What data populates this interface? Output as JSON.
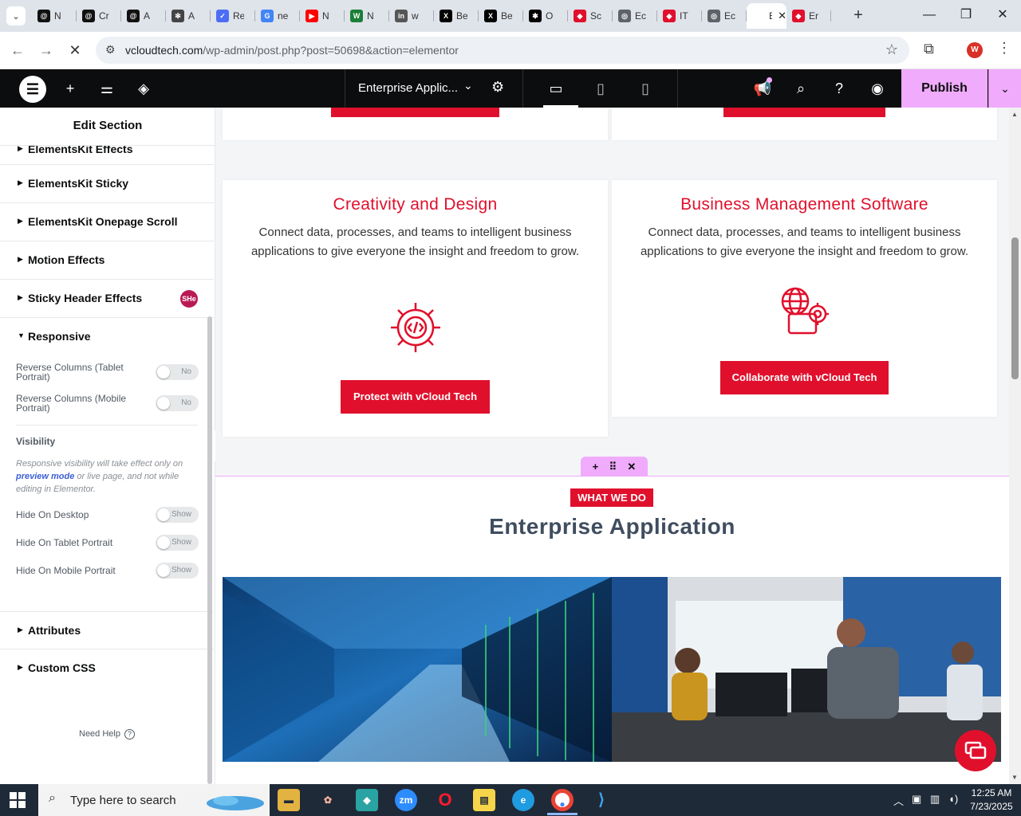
{
  "browser": {
    "tabs": [
      {
        "title": "N",
        "icon": "threads-icon",
        "color": "#111111",
        "glyph": "@"
      },
      {
        "title": "Cr",
        "icon": "threads-icon",
        "color": "#111111",
        "glyph": "@"
      },
      {
        "title": "A",
        "icon": "threads-icon",
        "color": "#111111",
        "glyph": "@"
      },
      {
        "title": "A",
        "icon": "openai-icon",
        "color": "#444444",
        "glyph": "✻"
      },
      {
        "title": "Re",
        "icon": "check-icon",
        "color": "#4c6ef5",
        "glyph": "✓"
      },
      {
        "title": "ne",
        "icon": "google-icon",
        "color": "#4285f4",
        "glyph": "G"
      },
      {
        "title": "N",
        "icon": "youtube-icon",
        "color": "#ff0000",
        "glyph": "▶"
      },
      {
        "title": "N",
        "icon": "w-icon",
        "color": "#1a7f37",
        "glyph": "W"
      },
      {
        "title": "w",
        "icon": "linkedin-icon",
        "color": "#555555",
        "glyph": "in"
      },
      {
        "title": "Be",
        "icon": "x-icon",
        "color": "#000000",
        "glyph": "X"
      },
      {
        "title": "Be",
        "icon": "x-icon",
        "color": "#000000",
        "glyph": "X"
      },
      {
        "title": "O",
        "icon": "asterisk-icon",
        "color": "#000000",
        "glyph": "✱"
      },
      {
        "title": "Sc",
        "icon": "diamond-icon",
        "color": "#e0102c",
        "glyph": "◆"
      },
      {
        "title": "Ec",
        "icon": "globe-icon",
        "color": "#5f6368",
        "glyph": "◎"
      },
      {
        "title": "IT",
        "icon": "diamond-icon",
        "color": "#e0102c",
        "glyph": "◆"
      },
      {
        "title": "Ec",
        "icon": "globe-icon",
        "color": "#5f6368",
        "glyph": "◎"
      },
      {
        "title": "Ec",
        "icon": "elementor-icon",
        "color": "#ffffff",
        "glyph": ""
      },
      {
        "title": "Er",
        "icon": "diamond-icon",
        "color": "#e0102c",
        "glyph": "◆"
      }
    ],
    "url_host": "vcloudtech.com",
    "url_path": "/wp-admin/post.php?post=50698&action=elementor",
    "profile_initial": "W"
  },
  "editor": {
    "document_title": "Enterprise Applic...",
    "publish_label": "Publish",
    "panel_title": "Edit Section",
    "accordions": {
      "elementskit_effects": "ElementsKit Effects",
      "elementskit_sticky": "ElementsKit Sticky",
      "elementskit_onepage": "ElementsKit Onepage Scroll",
      "motion_effects": "Motion Effects",
      "sticky_header": "Sticky Header Effects",
      "sticky_header_badge": "SHe",
      "responsive": "Responsive",
      "attributes": "Attributes",
      "custom_css": "Custom CSS"
    },
    "responsive": {
      "reverse_tablet_label": "Reverse Columns (Tablet Portrait)",
      "reverse_tablet_value": "No",
      "reverse_mobile_label": "Reverse Columns (Mobile Portrait)",
      "reverse_mobile_value": "No"
    },
    "visibility": {
      "heading": "Visibility",
      "note_before": "Responsive visibility will take effect only on",
      "note_link": "preview mode",
      "note_after": "or live page, and not while editing in Elementor.",
      "hide_desktop_label": "Hide On Desktop",
      "hide_desktop_value": "Show",
      "hide_tablet_label": "Hide On Tablet Portrait",
      "hide_tablet_value": "Show",
      "hide_mobile_label": "Hide On Mobile Portrait",
      "hide_mobile_value": "Show"
    },
    "need_help": "Need Help"
  },
  "page": {
    "card_left": {
      "title": "Creativity and Design",
      "text": "Connect data, processes, and teams to intelligent business applications to give everyone the insight and freedom to grow.",
      "button": "Protect with vCloud Tech"
    },
    "card_right": {
      "title": "Business Management Software",
      "text": "Connect data, processes, and teams to intelligent business applications to give everyone the insight and freedom to grow.",
      "button": "Collaborate with vCloud Tech"
    },
    "section_tag": "WHAT WE DO",
    "section_title": "Enterprise Application",
    "accent_color": "#e0102c"
  },
  "taskbar": {
    "search_placeholder": "Type here to search",
    "time": "12:25 AM",
    "date": "7/23/2025"
  }
}
